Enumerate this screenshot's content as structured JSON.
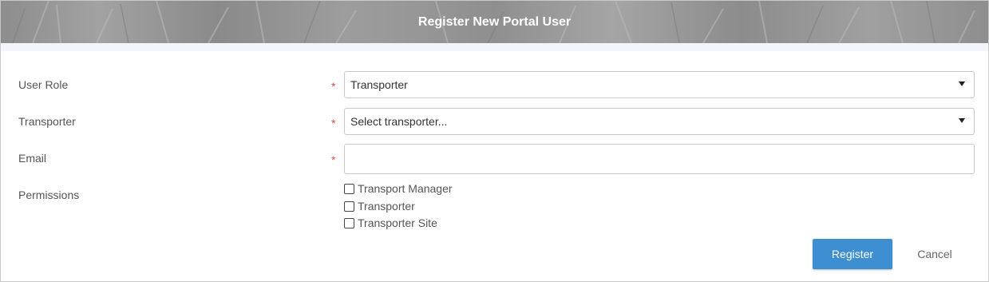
{
  "header": {
    "title": "Register New Portal User"
  },
  "form": {
    "user_role": {
      "label": "User Role",
      "required_mark": "*",
      "value": "Transporter"
    },
    "transporter": {
      "label": "Transporter",
      "required_mark": "*",
      "value": "Select transporter..."
    },
    "email": {
      "label": "Email",
      "required_mark": "*",
      "value": ""
    },
    "permissions": {
      "label": "Permissions",
      "options": [
        {
          "label": "Transport Manager",
          "checked": false
        },
        {
          "label": "Transporter",
          "checked": false
        },
        {
          "label": "Transporter Site",
          "checked": false
        }
      ]
    }
  },
  "actions": {
    "register_label": "Register",
    "cancel_label": "Cancel"
  },
  "colors": {
    "accent": "#3d8fd1",
    "required": "#d9534f",
    "header_text": "#ffffff"
  },
  "icons": {
    "dropdown": "caret-down-icon",
    "checkbox": "checkbox-icon"
  }
}
